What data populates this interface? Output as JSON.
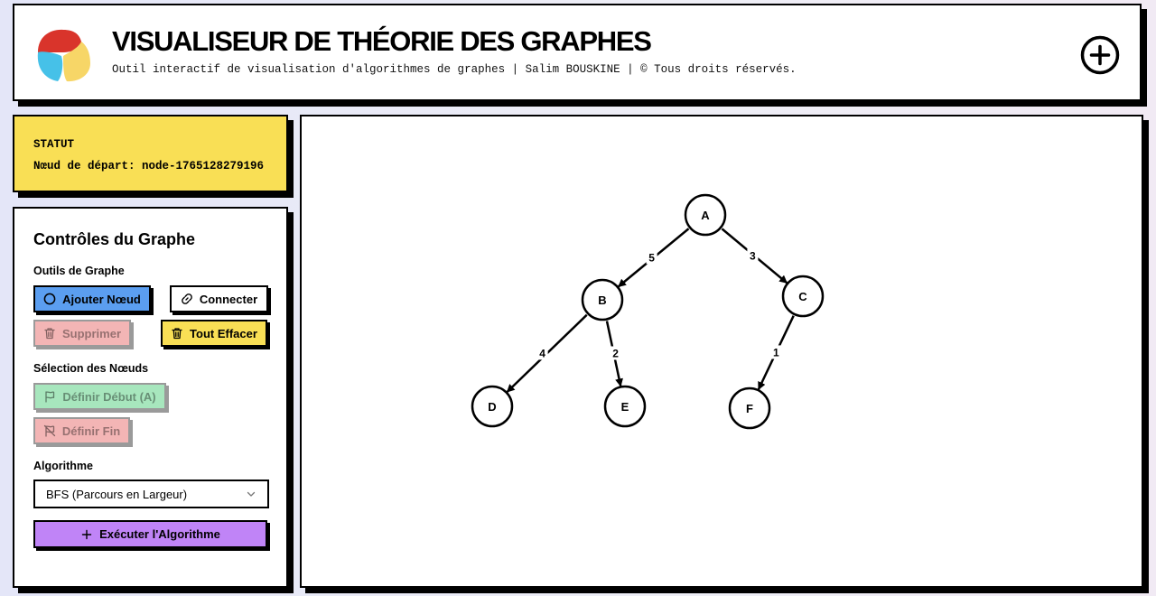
{
  "header": {
    "title": "VISUALISEUR DE THÉORIE DES GRAPHES",
    "subtitle": "Outil interactif de visualisation d'algorithmes de graphes | Salim BOUSKINE | © Tous droits réservés.",
    "add_icon": "plus-circle-icon"
  },
  "status": {
    "title": "STATUT",
    "message": "Nœud de départ: node-1765128279196"
  },
  "controls": {
    "title": "Contrôles du Graphe",
    "tools_label": "Outils de Graphe",
    "add_node_label": "Ajouter Nœud",
    "connect_label": "Connecter",
    "delete_label": "Supprimer",
    "clear_all_label": "Tout Effacer",
    "selection_label": "Sélection des Nœuds",
    "set_start_label": "Définir Début (A)",
    "set_end_label": "Définir Fin",
    "algorithm_label": "Algorithme",
    "algorithm_selected": "BFS (Parcours en Largeur)",
    "run_label": "Exécuter l'Algorithme"
  },
  "colors": {
    "blue": "#5b9ef0",
    "yellow": "#f9df55",
    "pink": "#f3b5b5",
    "green": "#a7e6bd",
    "purple": "#c084f7"
  },
  "graph": {
    "nodes": [
      {
        "id": "A"
      },
      {
        "id": "B"
      },
      {
        "id": "C"
      },
      {
        "id": "D"
      },
      {
        "id": "E"
      },
      {
        "id": "F"
      }
    ],
    "edges": [
      {
        "from": "A",
        "to": "B",
        "weight": "5"
      },
      {
        "from": "A",
        "to": "C",
        "weight": "3"
      },
      {
        "from": "B",
        "to": "D",
        "weight": "4"
      },
      {
        "from": "B",
        "to": "E",
        "weight": "2"
      },
      {
        "from": "C",
        "to": "F",
        "weight": "1"
      }
    ]
  }
}
